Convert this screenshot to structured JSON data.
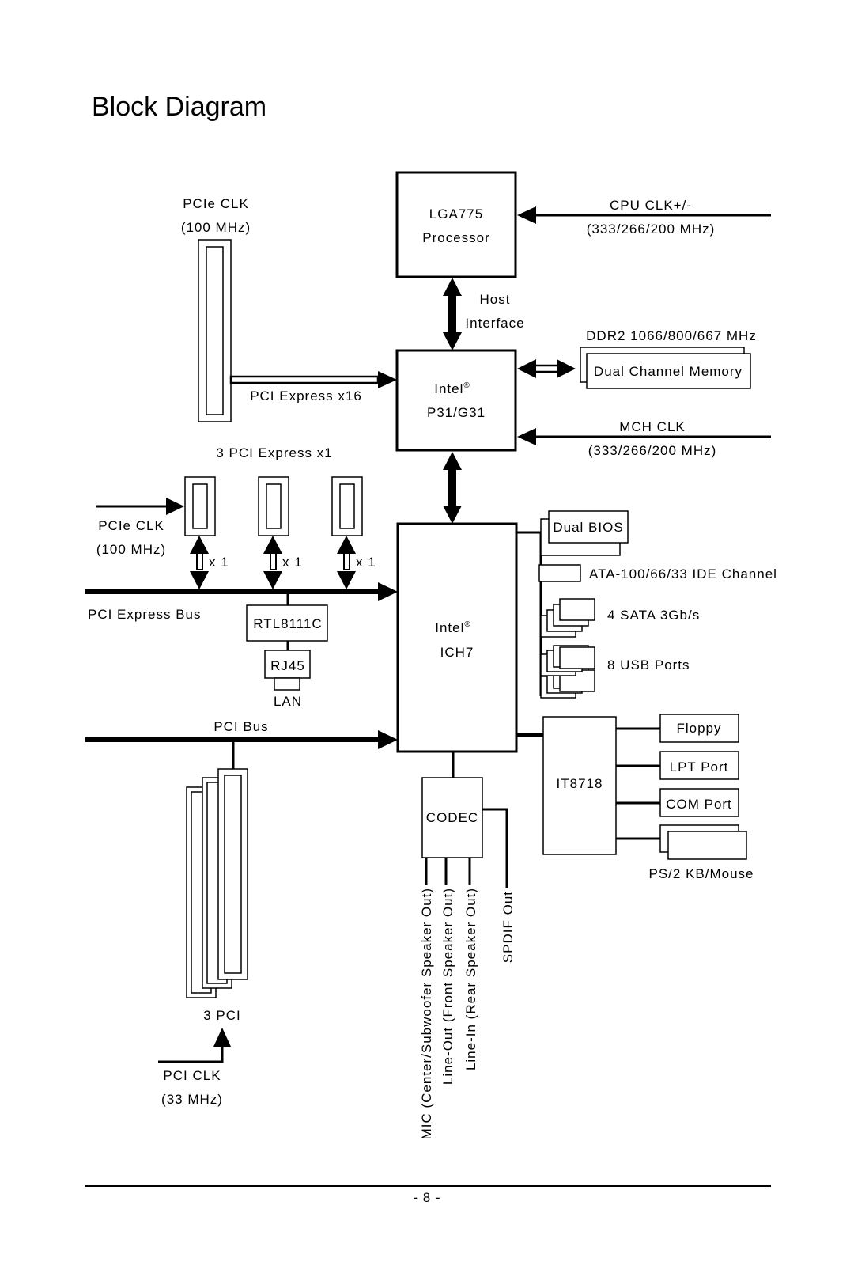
{
  "page": {
    "title": "Block Diagram",
    "page_number": "- 8 -"
  },
  "cpu": {
    "line1": "LGA775",
    "line2": "Processor"
  },
  "cpu_clk": {
    "line1": "CPU CLK+/-",
    "line2": "(333/266/200 MHz)"
  },
  "host_interface": {
    "line1": "Host",
    "line2": "Interface"
  },
  "pcie_clk_top": {
    "line1": "PCIe CLK",
    "line2": "(100 MHz)"
  },
  "pcie_x16_label": "PCI Express x16",
  "mch": {
    "line1": "Intel",
    "reg": "®",
    "line2": "P31/G31"
  },
  "memory": {
    "speed": "DDR2 1066/800/667 MHz",
    "label": "Dual Channel Memory"
  },
  "mch_clk": {
    "line1": "MCH CLK",
    "line2": "(333/266/200 MHz)"
  },
  "pcie_x1": {
    "label": "3 PCI Express x1",
    "lane_label": "x 1"
  },
  "pcie_clk_left": {
    "line1": "PCIe CLK",
    "line2": "(100 MHz)"
  },
  "pcie_bus_label": "PCI Express Bus",
  "lan": {
    "chip": "RTL8111C",
    "connector": "RJ45",
    "label": "LAN"
  },
  "pci_bus_label": "PCI Bus",
  "pci_slots_label": "3 PCI",
  "pci_clk": {
    "line1": "PCI CLK",
    "line2": "(33 MHz)"
  },
  "ich": {
    "line1": "Intel",
    "reg": "®",
    "line2": "ICH7"
  },
  "ich_peripherals": {
    "bios": "Dual BIOS",
    "ide": "ATA-100/66/33 IDE Channel",
    "sata": "4 SATA 3Gb/s",
    "usb": "8 USB Ports"
  },
  "superio": {
    "chip": "IT8718",
    "floppy": "Floppy",
    "lpt": "LPT Port",
    "com": "COM Port",
    "ps2": "PS/2 KB/Mouse"
  },
  "codec": {
    "label": "CODEC",
    "outputs": [
      "MIC (Center/Subwoofer Speaker Out)",
      "Line-Out (Front Speaker Out)",
      "Line-In (Rear Speaker Out)",
      "SPDIF Out"
    ]
  }
}
